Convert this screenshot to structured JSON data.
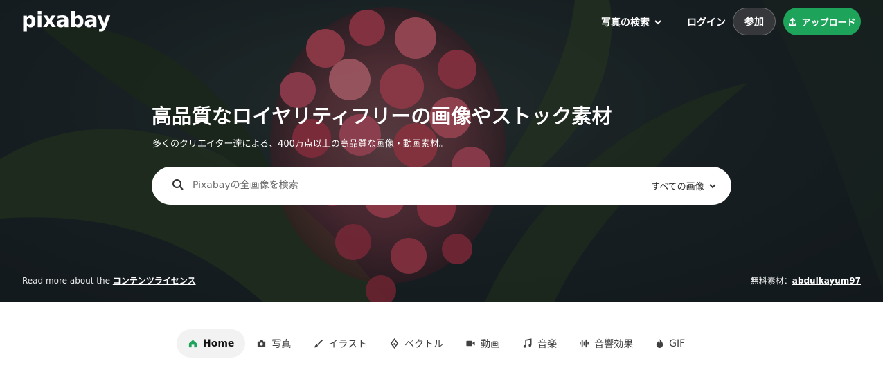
{
  "brand": {
    "logo_text": "pixabay"
  },
  "nav": {
    "explore_label": "写真の検索",
    "login_label": "ログイン",
    "join_label": "参加",
    "upload_label": "アップロード"
  },
  "hero": {
    "title": "高品質なロイヤリティフリーの画像やストック素材",
    "subtitle": "多くのクリエイター達による、400万点以上の高品質な画像・動画素材。",
    "search_placeholder": "Pixabayの全画像を検索",
    "search_filter": "すべての画像",
    "license_prefix": "Read more about the ",
    "license_link": "コンテンツライセンス",
    "credit_prefix": "無料素材：",
    "credit_user": "abdulkayum97"
  },
  "tabs": [
    {
      "label": "Home",
      "icon": "home-icon",
      "active": true
    },
    {
      "label": "写真",
      "icon": "camera-icon",
      "active": false
    },
    {
      "label": "イラスト",
      "icon": "brush-icon",
      "active": false
    },
    {
      "label": "ベクトル",
      "icon": "pen-nib-icon",
      "active": false
    },
    {
      "label": "動画",
      "icon": "video-icon",
      "active": false
    },
    {
      "label": "音楽",
      "icon": "music-icon",
      "active": false
    },
    {
      "label": "音響効果",
      "icon": "waveform-icon",
      "active": false
    },
    {
      "label": "GIF",
      "icon": "flame-icon",
      "active": false
    }
  ],
  "colors": {
    "accent": "#1ea35a",
    "hero_bg": "#1b2326",
    "flower": "#c4475b"
  }
}
